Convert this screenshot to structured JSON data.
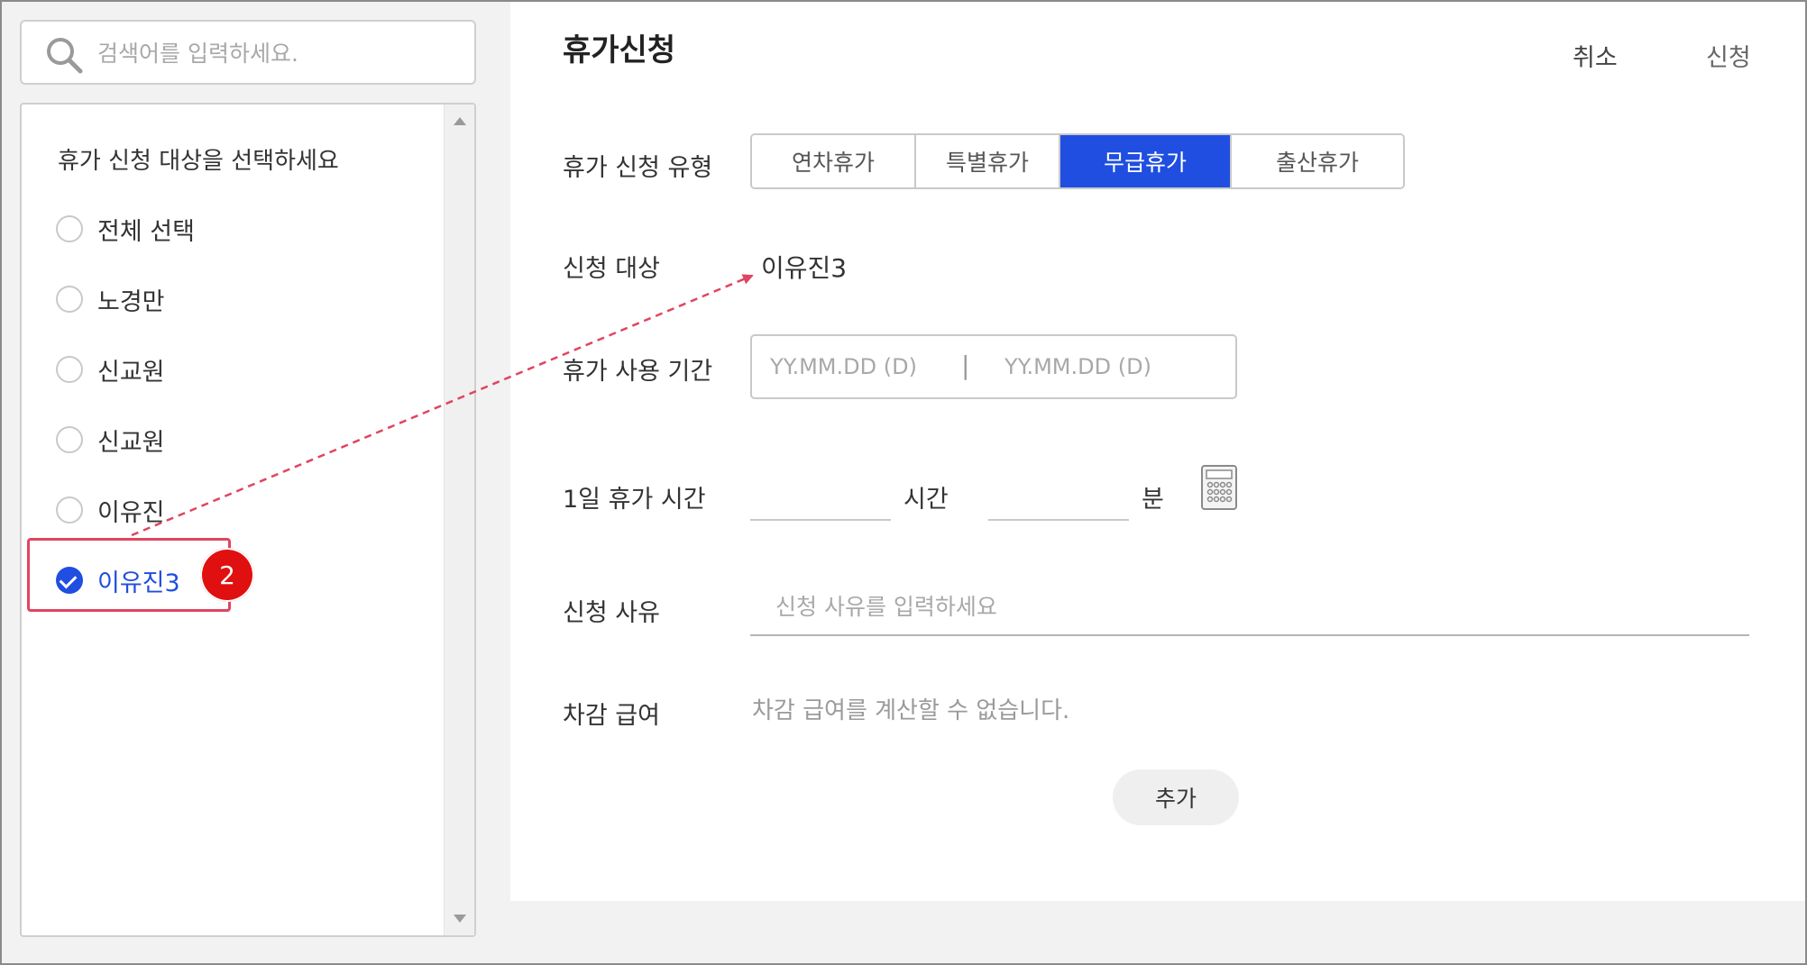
{
  "search": {
    "placeholder": "검색어를 입력하세요."
  },
  "list": {
    "title": "휴가 신청 대상을 선택하세요",
    "items": [
      {
        "label": "전체 선택",
        "checked": false
      },
      {
        "label": "노경만",
        "checked": false
      },
      {
        "label": "신교원",
        "checked": false
      },
      {
        "label": "신교원",
        "checked": false
      },
      {
        "label": "이유진",
        "checked": false
      },
      {
        "label": "이유진3",
        "checked": true
      }
    ]
  },
  "annotation": {
    "step": "2"
  },
  "form": {
    "title": "휴가신청",
    "cancel_label": "취소",
    "submit_label": "신청",
    "type_label": "휴가 신청 유형",
    "types": [
      "연차휴가",
      "특별휴가",
      "무급휴가",
      "출산휴가"
    ],
    "selected_type": "무급휴가",
    "target_label": "신청 대상",
    "target_value": "이유진3",
    "period_label": "휴가 사용 기간",
    "date_start_placeholder": "YY.MM.DD (D)",
    "date_separator": "|",
    "date_end_placeholder": "YY.MM.DD (D)",
    "daily_time_label": "1일 휴가 시간",
    "hours_unit": "시간",
    "minutes_unit": "분",
    "reason_label": "신청 사유",
    "reason_placeholder": "신청 사유를 입력하세요",
    "deduction_label": "차감 급여",
    "deduction_value": "차감 급여를 계산할 수 없습니다.",
    "add_label": "추가"
  },
  "colors": {
    "accent": "#1f4ee0",
    "annotation": "#e0455f",
    "badge": "#e01010"
  }
}
